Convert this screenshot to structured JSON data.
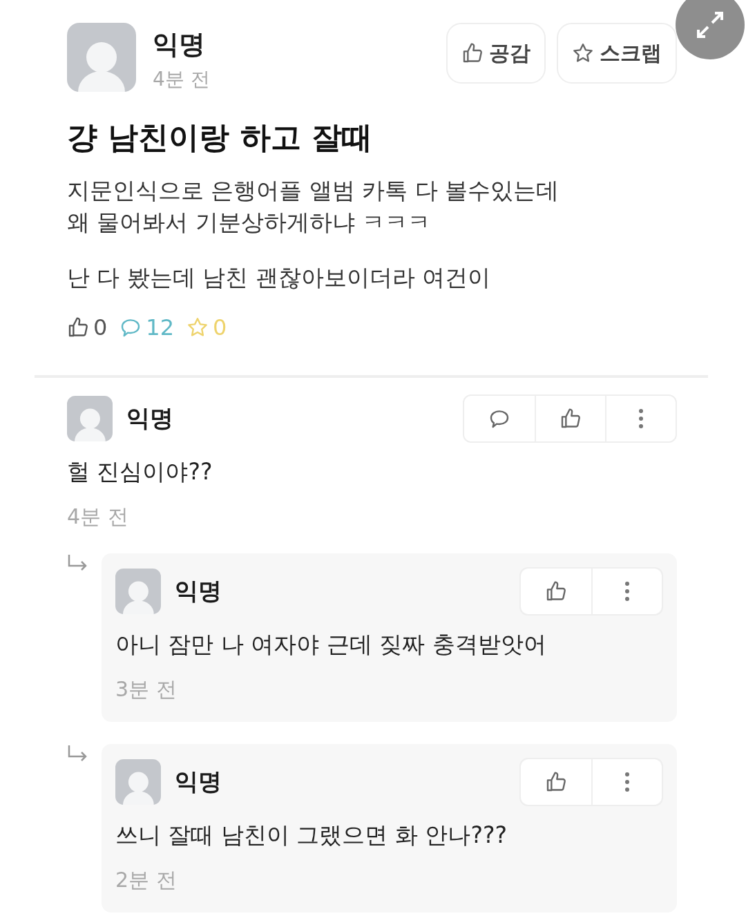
{
  "post": {
    "author": "익명",
    "time": "4분 전",
    "actions": [
      {
        "kind": "like",
        "label": "공감"
      },
      {
        "kind": "scrap",
        "label": "스크랩"
      }
    ],
    "title": "걍 남친이랑 하고 잘때",
    "body": [
      [
        "지문인식으로 은행어플 앨범 카톡 다 볼수있는데",
        "왜 물어봐서 기분상하게하냐 ㅋㅋㅋ"
      ],
      [
        "난 다 봤는데 남친 괜찮아보이더라 여건이"
      ]
    ],
    "stats": [
      {
        "kind": "like",
        "count": "0",
        "color": "#555555"
      },
      {
        "kind": "comment",
        "count": "12",
        "color": "#5fb8c6"
      },
      {
        "kind": "scrap",
        "count": "0",
        "color": "#eed36c"
      }
    ]
  },
  "comments": [
    {
      "author": "익명",
      "text": "헐 진심이야??",
      "time": "4분 전",
      "actions": [
        {
          "kind": "reply"
        },
        {
          "kind": "like"
        },
        {
          "kind": "more"
        }
      ],
      "replies": [
        {
          "author": "익명",
          "text": "아니 잠만 나 여자야 근데 짖짜 충격받앗어",
          "time": "3분 전",
          "actions": [
            {
              "kind": "like"
            },
            {
              "kind": "more"
            }
          ]
        },
        {
          "author": "익명",
          "text": "쓰니 잘때 남친이 그랬으면 화 안나???",
          "time": "2분 전",
          "actions": [
            {
              "kind": "like"
            },
            {
              "kind": "more"
            }
          ]
        }
      ]
    }
  ]
}
